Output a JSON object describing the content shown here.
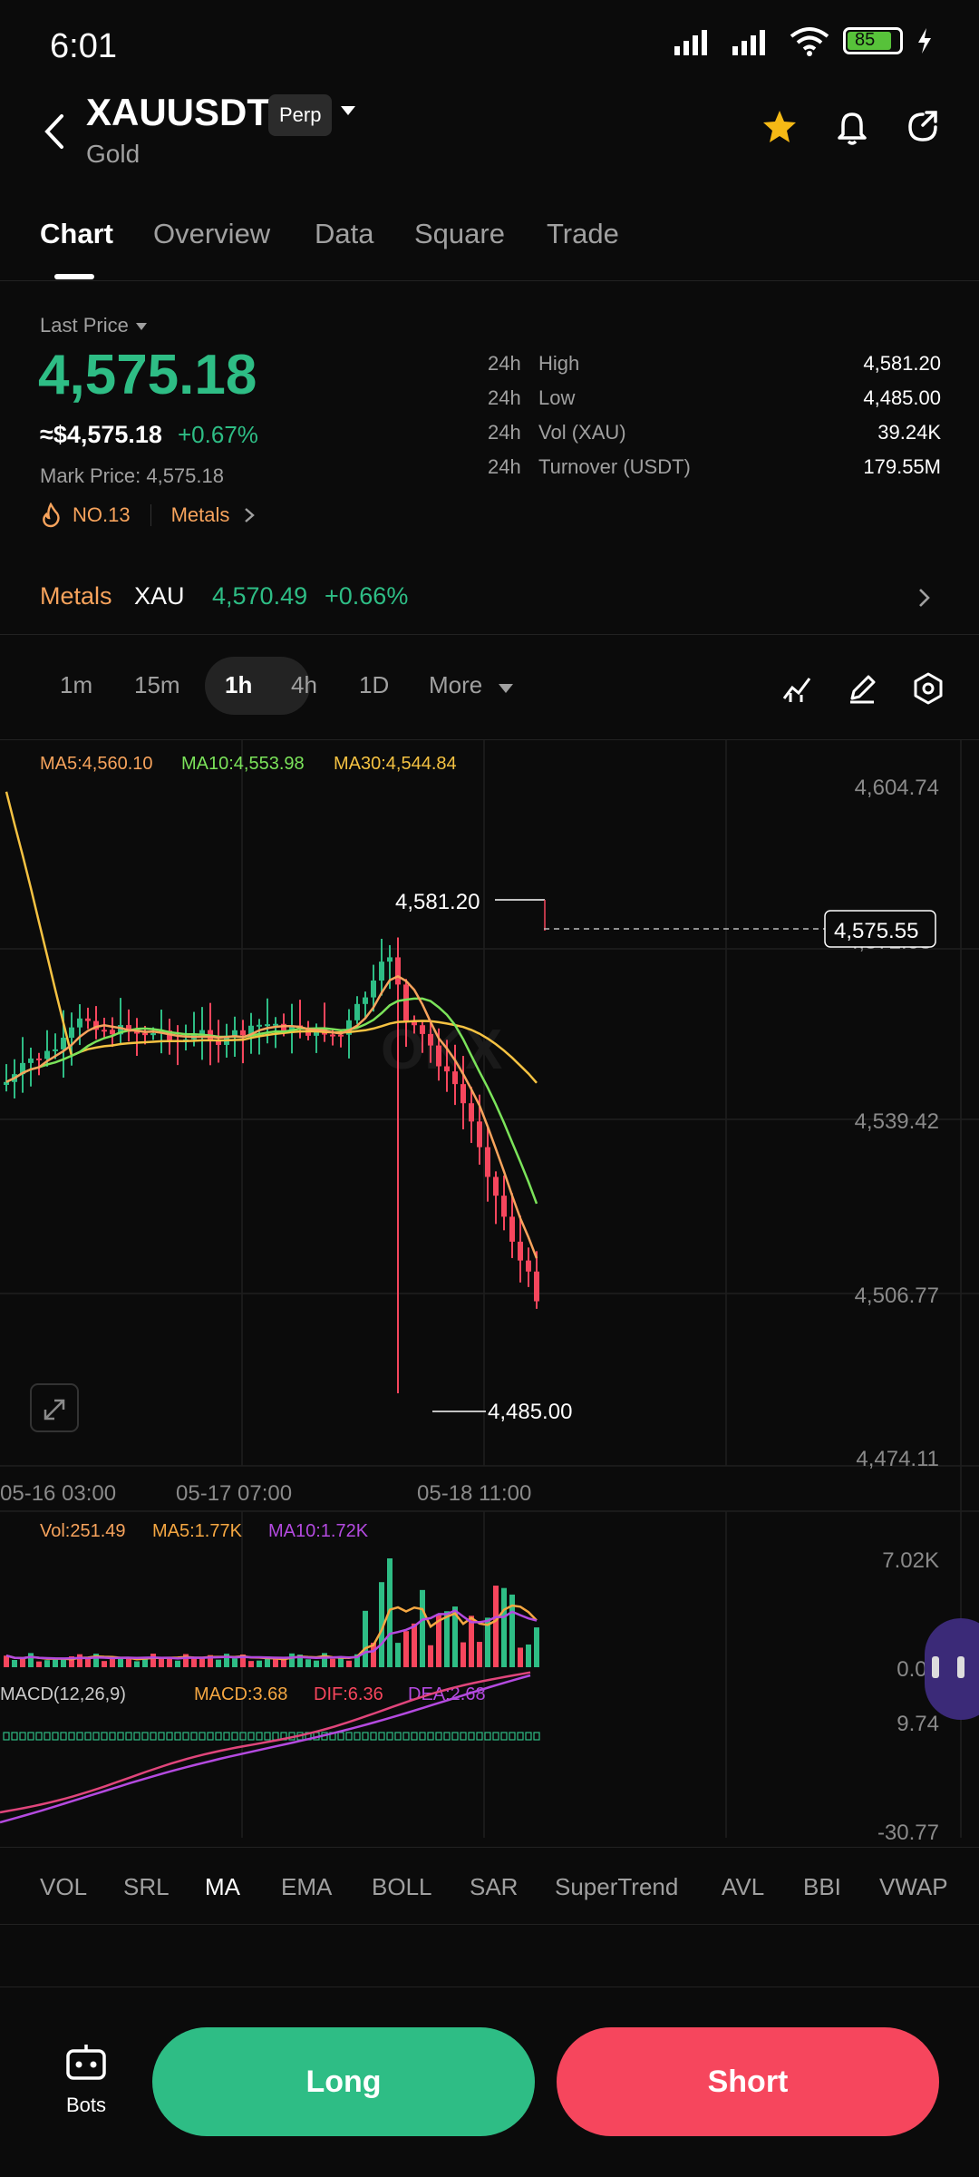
{
  "status": {
    "time": "6:01",
    "battery": "85"
  },
  "header": {
    "symbol": "XAUUSDT",
    "badge": "Perp",
    "subtitle": "Gold"
  },
  "tabs": [
    {
      "label": "Chart"
    },
    {
      "label": "Overview"
    },
    {
      "label": "Data"
    },
    {
      "label": "Square"
    },
    {
      "label": "Trade"
    }
  ],
  "price": {
    "label": "Last Price",
    "last": "4,575.18",
    "usd": "≈$4,575.18",
    "change": "+0.67%",
    "mark": "Mark Price: 4,575.18",
    "rank": "NO.13",
    "category": "Metals"
  },
  "stats": [
    {
      "pre": "24h",
      "label": "High",
      "value": "4,581.20"
    },
    {
      "pre": "24h",
      "label": "Low",
      "value": "4,485.00"
    },
    {
      "pre": "24h",
      "label": "Vol (XAU)",
      "value": "39.24K"
    },
    {
      "pre": "24h",
      "label": "Turnover (USDT)",
      "value": "179.55M"
    }
  ],
  "metals_bar": {
    "label": "Metals",
    "asset": "XAU",
    "price": "4,570.49",
    "change": "+0.66%"
  },
  "intervals": [
    {
      "label": "1m"
    },
    {
      "label": "15m"
    },
    {
      "label": "1h"
    },
    {
      "label": "4h"
    },
    {
      "label": "1D"
    },
    {
      "label": "More"
    }
  ],
  "chart": {
    "ma5": "MA5:4,560.10",
    "ma10": "MA10:4,553.98",
    "ma30": "MA30:4,544.84",
    "y_ticks": [
      "4,604.74",
      "4,539.42",
      "4,506.77",
      "4,474.11"
    ],
    "x_ticks": [
      "05-16 03:00",
      "05-17 07:00",
      "05-18 11:00"
    ],
    "high_label": "4,581.20",
    "low_label": "4,485.00",
    "current_label": "4,575.55",
    "vol_label": "Vol:251.49",
    "vol_ma5": "MA5:1.77K",
    "vol_ma10": "MA10:1.72K",
    "vol_ticks": [
      "7.02K",
      "0.00"
    ],
    "macd_label": "MACD(12,26,9)",
    "macd_val": "MACD:3.68",
    "dif": "DIF:6.36",
    "dea": "DEA:2.68",
    "macd_ticks": [
      "9.74",
      "-30.77"
    ],
    "colors": {
      "up": "#2ebd85",
      "down": "#f6465d",
      "ma5": "#f7a35c",
      "ma10": "#7be35a",
      "ma30": "#f5c242",
      "macd_dif": "#e0457b",
      "macd_dea": "#b44ae0"
    }
  },
  "indicators": [
    {
      "label": "VOL"
    },
    {
      "label": "SRL"
    },
    {
      "label": "MA"
    },
    {
      "label": "EMA"
    },
    {
      "label": "BOLL"
    },
    {
      "label": "SAR"
    },
    {
      "label": "SuperTrend"
    },
    {
      "label": "AVL"
    },
    {
      "label": "BBI"
    },
    {
      "label": "VWAP"
    }
  ],
  "actions": {
    "bots": "Bots",
    "long": "Long",
    "short": "Short"
  }
}
